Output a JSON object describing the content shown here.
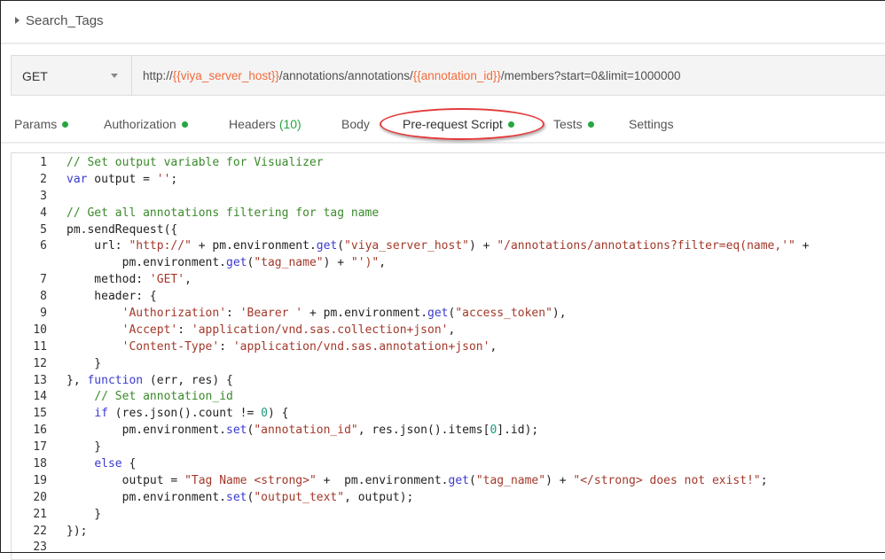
{
  "request": {
    "name": "Search_Tags"
  },
  "url_bar": {
    "method": "GET",
    "url_parts": [
      {
        "text": "http://",
        "var": false
      },
      {
        "text": "{{viya_server_host}}",
        "var": true
      },
      {
        "text": "/annotations/annotations/",
        "var": false
      },
      {
        "text": "{{annotation_id}}",
        "var": true
      },
      {
        "text": "/members?start=0&limit=1000000",
        "var": false
      }
    ]
  },
  "tabs": [
    {
      "label": "Params",
      "dot": true
    },
    {
      "label": "Authorization",
      "dot": true
    },
    {
      "label": "Headers",
      "count": "(10)"
    },
    {
      "label": "Body"
    },
    {
      "label": "Pre-request Script",
      "dot": true,
      "active": true
    },
    {
      "label": "Tests",
      "dot": true
    },
    {
      "label": "Settings"
    }
  ],
  "colors": {
    "accent_green": "#26a641",
    "variable": "#f26b3a",
    "highlight_ring": "#e43b3b"
  },
  "code_lines": [
    {
      "n": "1",
      "t": [
        [
          "c",
          "// Set output variable for Visualizer"
        ]
      ]
    },
    {
      "n": "2",
      "t": [
        [
          "k",
          "var"
        ],
        [
          "p",
          " output = "
        ],
        [
          "s",
          "''"
        ],
        [
          "p",
          ";"
        ]
      ]
    },
    {
      "n": "3",
      "t": []
    },
    {
      "n": "4",
      "t": [
        [
          "c",
          "// Get all annotations filtering for tag name"
        ]
      ]
    },
    {
      "n": "5",
      "t": [
        [
          "p",
          "pm.sendRequest({"
        ]
      ]
    },
    {
      "n": "6",
      "t": [
        [
          "p",
          "    url: "
        ],
        [
          "s",
          "\"http://\""
        ],
        [
          "p",
          " + pm.environment."
        ],
        [
          "f",
          "get"
        ],
        [
          "p",
          "("
        ],
        [
          "s",
          "\"viya_server_host\""
        ],
        [
          "p",
          ") + "
        ],
        [
          "s",
          "\"/annotations/annotations?filter=eq(name,'\""
        ],
        [
          "p",
          " +"
        ]
      ]
    },
    {
      "n": "",
      "t": [
        [
          "p",
          "        pm.environment."
        ],
        [
          "f",
          "get"
        ],
        [
          "p",
          "("
        ],
        [
          "s",
          "\"tag_name\""
        ],
        [
          "p",
          ") + "
        ],
        [
          "s",
          "\"')\""
        ],
        [
          "p",
          ","
        ]
      ]
    },
    {
      "n": "7",
      "t": [
        [
          "p",
          "    method: "
        ],
        [
          "s",
          "'GET'"
        ],
        [
          "p",
          ","
        ]
      ]
    },
    {
      "n": "8",
      "t": [
        [
          "p",
          "    header: {"
        ]
      ]
    },
    {
      "n": "9",
      "t": [
        [
          "p",
          "        "
        ],
        [
          "s",
          "'Authorization'"
        ],
        [
          "p",
          ": "
        ],
        [
          "s",
          "'Bearer '"
        ],
        [
          "p",
          " + pm.environment."
        ],
        [
          "f",
          "get"
        ],
        [
          "p",
          "("
        ],
        [
          "s",
          "\"access_token\""
        ],
        [
          "p",
          "),"
        ]
      ]
    },
    {
      "n": "10",
      "t": [
        [
          "p",
          "        "
        ],
        [
          "s",
          "'Accept'"
        ],
        [
          "p",
          ": "
        ],
        [
          "s",
          "'application/vnd.sas.collection+json'"
        ],
        [
          "p",
          ","
        ]
      ]
    },
    {
      "n": "11",
      "t": [
        [
          "p",
          "        "
        ],
        [
          "s",
          "'Content-Type'"
        ],
        [
          "p",
          ": "
        ],
        [
          "s",
          "'application/vnd.sas.annotation+json'"
        ],
        [
          "p",
          ","
        ]
      ]
    },
    {
      "n": "12",
      "t": [
        [
          "p",
          "    }"
        ]
      ]
    },
    {
      "n": "13",
      "t": [
        [
          "p",
          "}, "
        ],
        [
          "k",
          "function"
        ],
        [
          "p",
          " (err, res) {"
        ]
      ]
    },
    {
      "n": "14",
      "t": [
        [
          "p",
          "    "
        ],
        [
          "c",
          "// Set annotation_id"
        ]
      ]
    },
    {
      "n": "15",
      "t": [
        [
          "p",
          "    "
        ],
        [
          "k",
          "if"
        ],
        [
          "p",
          " (res.json().count != "
        ],
        [
          "n",
          "0"
        ],
        [
          "p",
          ") {"
        ]
      ]
    },
    {
      "n": "16",
      "t": [
        [
          "p",
          "        pm.environment."
        ],
        [
          "f",
          "set"
        ],
        [
          "p",
          "("
        ],
        [
          "s",
          "\"annotation_id\""
        ],
        [
          "p",
          ", res.json().items["
        ],
        [
          "n",
          "0"
        ],
        [
          "p",
          "].id);"
        ]
      ]
    },
    {
      "n": "17",
      "t": [
        [
          "p",
          "    }"
        ]
      ]
    },
    {
      "n": "18",
      "t": [
        [
          "p",
          "    "
        ],
        [
          "k",
          "else"
        ],
        [
          "p",
          " {"
        ]
      ]
    },
    {
      "n": "19",
      "t": [
        [
          "p",
          "        output = "
        ],
        [
          "s",
          "\"Tag Name <strong>\""
        ],
        [
          "p",
          " +  pm.environment."
        ],
        [
          "f",
          "get"
        ],
        [
          "p",
          "("
        ],
        [
          "s",
          "\"tag_name\""
        ],
        [
          "p",
          ") + "
        ],
        [
          "s",
          "\"</strong> does not exist!\""
        ],
        [
          "p",
          ";"
        ]
      ]
    },
    {
      "n": "20",
      "t": [
        [
          "p",
          "        pm.environment."
        ],
        [
          "f",
          "set"
        ],
        [
          "p",
          "("
        ],
        [
          "s",
          "\"output_text\""
        ],
        [
          "p",
          ", output);"
        ]
      ]
    },
    {
      "n": "21",
      "t": [
        [
          "p",
          "    }"
        ]
      ]
    },
    {
      "n": "22",
      "t": [
        [
          "p",
          "});"
        ]
      ]
    },
    {
      "n": "23",
      "t": []
    }
  ]
}
